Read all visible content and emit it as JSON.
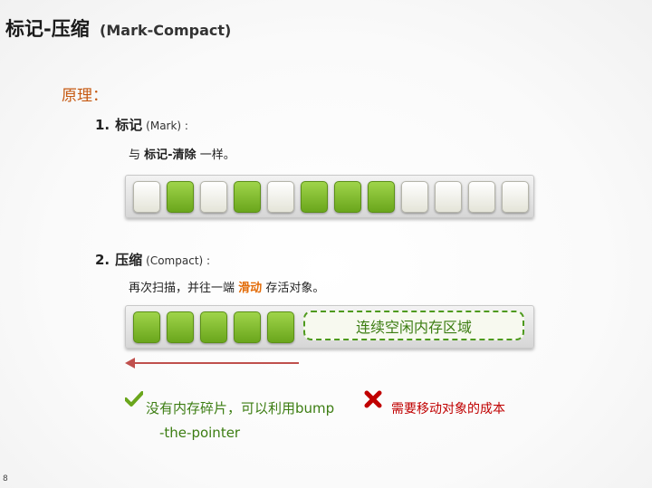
{
  "title": {
    "main": "标记-压缩",
    "sub": "(Mark-Compact)"
  },
  "subtitle": "原理：",
  "step1": {
    "number": "1.",
    "label": "标记",
    "en": "(Mark) :",
    "desc_prefix": "与",
    "desc_strong": "标记-清除",
    "desc_suffix": "一样。",
    "cells": [
      "free",
      "used",
      "free",
      "used",
      "free",
      "used",
      "used",
      "used",
      "free",
      "free",
      "free",
      "free"
    ]
  },
  "step2": {
    "number": "2.",
    "label": "压缩",
    "en": "(Compact) :",
    "desc_prefix": "再次扫描，并往一端",
    "desc_highlight": "滑动",
    "desc_suffix": "存活对象。",
    "cells": [
      "used",
      "used",
      "used",
      "used",
      "used"
    ],
    "free_region_label": "连续空闲内存区域"
  },
  "notes": {
    "pro_line1": "没有内存碎片，可以利用bump",
    "pro_line2": "-the-pointer",
    "con": "需要移动对象的成本"
  },
  "colors": {
    "used": "#7cb82f",
    "free": "#f2f2e8",
    "accent_orange": "#c65911",
    "check_green": "#3c7d12",
    "cross_red": "#c00000",
    "arrow_red": "#c0504d"
  },
  "page_number": "8"
}
